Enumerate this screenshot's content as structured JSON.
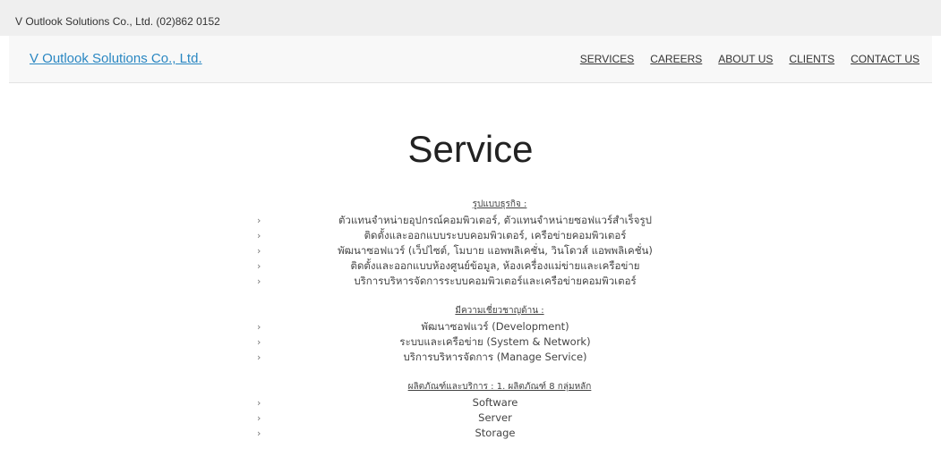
{
  "topbar": {
    "contact": "V Outlook Solutions Co., Ltd. (02)862 0152"
  },
  "navbar": {
    "brand": "V Outlook Solutions Co., Ltd.",
    "links": [
      "SERVICES",
      "CAREERS",
      "ABOUT US",
      "CLIENTS",
      "CONTACT US"
    ]
  },
  "page": {
    "title": "Service",
    "arrow": "›",
    "sections": [
      {
        "heading": "รูปแบบธุรกิจ :",
        "items": [
          "ตัวแทนจำหน่ายอุปกรณ์คอมพิวเตอร์, ตัวแทนจำหน่ายซอฟแวร์สำเร็จรูป",
          "ติดตั้งและออกแบบระบบคอมพิวเตอร์, เครือข่ายคอมพิวเตอร์",
          "พัฒนาซอฟแวร์ (เว็ปไซต์, โมบาย แอพพลิเคชั่น, วินโดวส์ แอพพลิเคชั่น)",
          "ติดตั้งและออกแบบห้องศูนย์ข้อมูล, ห้องเครื่องแม่ข่ายและเครือข่าย",
          "บริการบริหารจัดการระบบคอมพิวเตอร์และเครือข่ายคอมพิวเตอร์"
        ]
      },
      {
        "heading": "มีความเชี่ยวชาญด้าน :",
        "items": [
          "พัฒนาซอฟแวร์ (Development)",
          "ระบบและเครือข่าย (System & Network)",
          "บริการบริหารจัดการ (Manage Service)"
        ]
      },
      {
        "heading": "ผลิตภัณฑ์และบริการ : 1. ผลิตภัณฑ์ 8 กลุ่มหลัก",
        "items": [
          "Software",
          "Server",
          "Storage"
        ]
      }
    ]
  }
}
